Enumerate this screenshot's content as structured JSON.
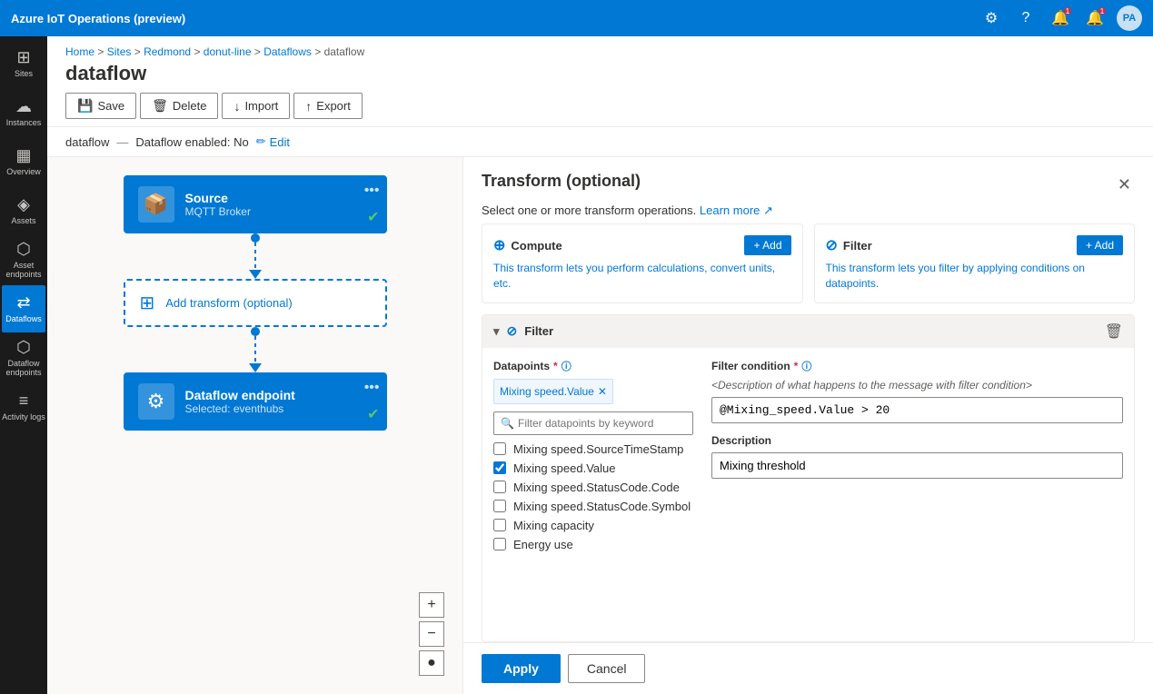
{
  "app": {
    "title": "Azure IoT Operations (preview)"
  },
  "nav_icons": {
    "settings": "⚙",
    "help": "?",
    "bell1": "🔔",
    "bell2": "🔔",
    "avatar": "PA"
  },
  "sidebar": {
    "items": [
      {
        "id": "sites",
        "icon": "⊞",
        "label": "Sites"
      },
      {
        "id": "instances",
        "icon": "☁",
        "label": "Instances"
      },
      {
        "id": "overview",
        "icon": "▦",
        "label": "Overview"
      },
      {
        "id": "assets",
        "icon": "◈",
        "label": "Assets"
      },
      {
        "id": "asset-endpoints",
        "icon": "⬡",
        "label": "Asset endpoints"
      },
      {
        "id": "dataflows",
        "icon": "⇄",
        "label": "Dataflows",
        "active": true
      },
      {
        "id": "dataflow-endpoints",
        "icon": "⬡",
        "label": "Dataflow endpoints"
      },
      {
        "id": "activity-logs",
        "icon": "≡",
        "label": "Activity logs"
      }
    ]
  },
  "breadcrumb": {
    "parts": [
      "Home",
      "Sites",
      "Redmond",
      "donut-line",
      "Dataflows",
      "dataflow"
    ],
    "text": "Home > Sites > Redmond > donut-line > Dataflows > dataflow"
  },
  "page": {
    "title": "dataflow"
  },
  "toolbar": {
    "save_label": "Save",
    "delete_label": "Delete",
    "import_label": "Import",
    "export_label": "Export"
  },
  "sub_header": {
    "name": "dataflow",
    "status": "Dataflow enabled: No",
    "edit_label": "Edit"
  },
  "flow": {
    "source": {
      "title": "Source",
      "subtitle": "MQTT Broker"
    },
    "transform": {
      "label": "Add transform (optional)"
    },
    "endpoint": {
      "title": "Dataflow endpoint",
      "subtitle": "Selected: eventhubs"
    }
  },
  "panel": {
    "title": "Transform (optional)",
    "subtitle": "Select one or more transform operations.",
    "learn_more": "Learn more",
    "cards": [
      {
        "id": "compute",
        "icon": "⊕",
        "title": "Compute",
        "add_label": "+ Add",
        "desc": "This transform lets you perform calculations, convert units, etc."
      },
      {
        "id": "filter",
        "icon": "⊘",
        "title": "Filter",
        "add_label": "+ Add",
        "desc": "This transform lets you filter by applying conditions on datapoints."
      }
    ],
    "filter_section": {
      "title": "Filter",
      "datapoints_label": "Datapoints",
      "datapoints_required": true,
      "selected_tags": [
        "Mixing speed.Value"
      ],
      "search_placeholder": "Filter datapoints by keyword",
      "checkboxes": [
        {
          "id": "cb1",
          "label": "Mixing speed.SourceTimeStamp",
          "checked": false
        },
        {
          "id": "cb2",
          "label": "Mixing speed.Value",
          "checked": true
        },
        {
          "id": "cb3",
          "label": "Mixing speed.StatusCode.Code",
          "checked": false
        },
        {
          "id": "cb4",
          "label": "Mixing speed.StatusCode.Symbol",
          "checked": false
        },
        {
          "id": "cb5",
          "label": "Mixing capacity",
          "checked": false
        },
        {
          "id": "cb6",
          "label": "Energy use",
          "checked": false
        }
      ],
      "filter_condition_label": "Filter condition",
      "filter_condition_required": true,
      "filter_condition_desc": "<Description of what happens to the message with filter condition>",
      "filter_value": "@Mixing_speed.Value > 20",
      "description_label": "Description",
      "description_value": "Mixing threshold"
    },
    "apply_label": "Apply",
    "cancel_label": "Cancel"
  },
  "canvas_controls": {
    "plus": "+",
    "minus": "−",
    "dot": "●"
  }
}
